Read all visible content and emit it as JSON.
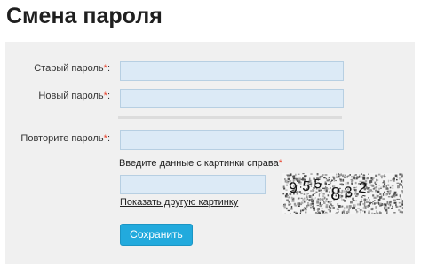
{
  "page": {
    "title": "Смена пароля"
  },
  "form": {
    "required_mark": "*",
    "old_password": {
      "label": "Старый пароль",
      "suffix": ":",
      "value": ""
    },
    "new_password": {
      "label": "Новый пароль",
      "suffix": ":",
      "value": ""
    },
    "repeat_password": {
      "label": "Повторите пароль",
      "suffix": ":",
      "value": ""
    },
    "captcha": {
      "hint": "Введите данные с картинки справа",
      "value": "",
      "refresh_link": "Показать другую картинку",
      "image_text": "955832",
      "image_icon": "captcha-image"
    },
    "submit_label": "Сохранить"
  },
  "colors": {
    "panel": "#f0f0f0",
    "field": "#dceaf6",
    "required": "#e8402a",
    "button": "#22aadd"
  }
}
